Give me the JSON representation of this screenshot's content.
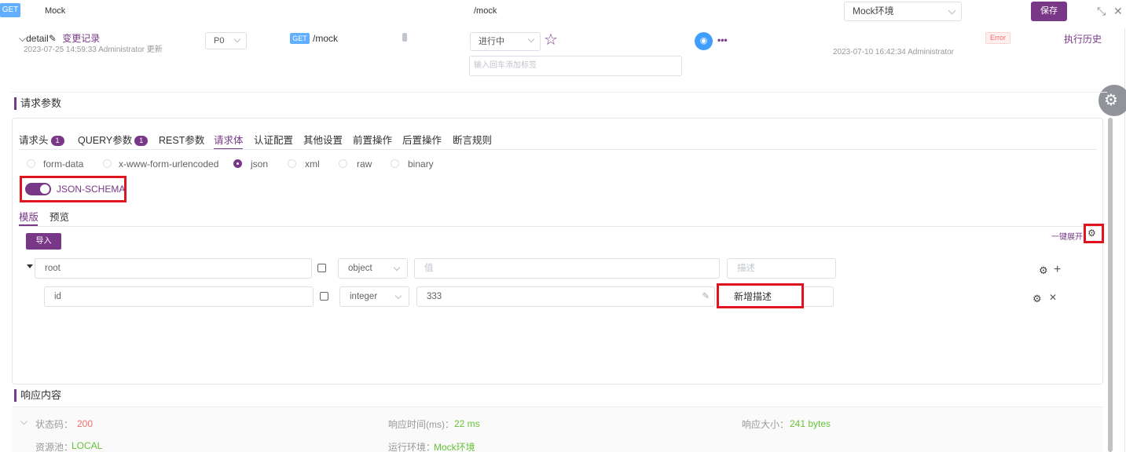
{
  "topbar": {
    "method": "GET",
    "name": "Mock",
    "path": "/mock",
    "env_select": "Mock环境",
    "save_label": "保存",
    "shrink_icon": "⤡",
    "close_icon": "✕"
  },
  "info": {
    "title": "detail",
    "change_record": "变更记录",
    "updated": "2023-07-25 14:59:33 Administrator 更新",
    "priority": "P0",
    "method": "GET",
    "path": "/mock",
    "status": "进行中",
    "tag_placeholder": "输入回车添加标签",
    "last_run": "2023-07-10 16:42:34 Administrator",
    "result": "Error",
    "history_label": "执行历史"
  },
  "request": {
    "section_title": "请求参数",
    "tabs": [
      {
        "label": "请求头",
        "badge": "1"
      },
      {
        "label": "QUERY参数",
        "badge": "1"
      },
      {
        "label": "REST参数"
      },
      {
        "label": "请求体"
      },
      {
        "label": "认证配置"
      },
      {
        "label": "其他设置"
      },
      {
        "label": "前置操作"
      },
      {
        "label": "后置操作"
      },
      {
        "label": "断言规则"
      }
    ],
    "body_types": [
      "form-data",
      "x-www-form-urlencoded",
      "json",
      "xml",
      "raw",
      "binary"
    ],
    "selected_body_type": "json",
    "json_schema_label": "JSON-SCHEMA",
    "sub_tabs": [
      "模版",
      "预览"
    ],
    "import_label": "导入",
    "expand_all_label": "一键展开",
    "schema_rows": [
      {
        "name": "root",
        "type": "object",
        "value_placeholder": "值",
        "desc_placeholder": "描述"
      },
      {
        "name": "id",
        "type": "integer",
        "value": "333",
        "desc": "新增描述"
      }
    ]
  },
  "response": {
    "section_title": "响应内容",
    "status_label": "状态码：",
    "status_value": "200",
    "time_label": "响应时间(ms)：",
    "time_value": "22 ms",
    "size_label": "响应大小：",
    "size_value": "241 bytes",
    "pool_label": "资源池：",
    "pool_value": "LOCAL",
    "env_label": "运行环境：",
    "env_value": "Mock环境"
  },
  "colors": {
    "accent": "#783887",
    "get_blue": "#61affe",
    "highlight_red": "#e0141e",
    "success": "#67c23a",
    "error": "#f56c6c"
  }
}
